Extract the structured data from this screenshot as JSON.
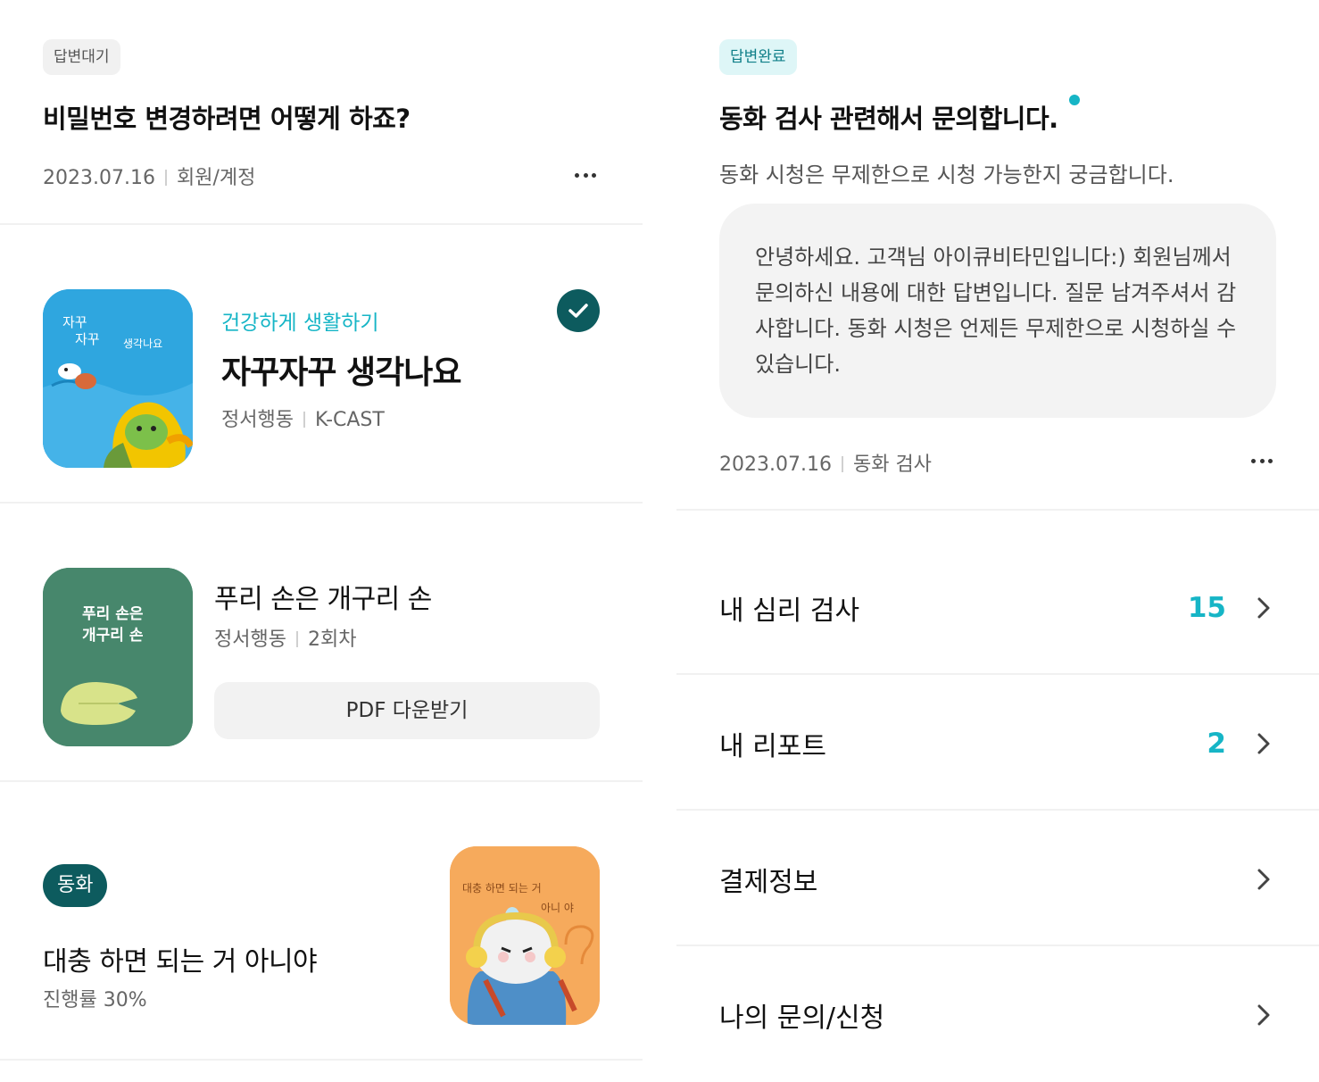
{
  "inquiry_pending": {
    "status": "답변대기",
    "title": "비밀번호 변경하려면 어떻게 하죠?",
    "date": "2023.07.16",
    "category": "회원/계정"
  },
  "content_card": {
    "thumb_text_line1": "자꾸",
    "thumb_text_line2": "자꾸",
    "thumb_text_line3": "생각나요",
    "category": "건강하게 생활하기",
    "title": "자꾸자꾸 생각나요",
    "tag": "정서행동",
    "source": "K-CAST",
    "check_color": "#0d5b5e"
  },
  "pdf_card": {
    "thumb_text_line1": "푸리 손은",
    "thumb_text_line2": "개구리 손",
    "title": "푸리 손은 개구리 손",
    "tag": "정서행동",
    "episode": "2회차",
    "button_label": "PDF 다운받기"
  },
  "progress_card": {
    "badge": "동화",
    "title": "대충 하면 되는 거 아니야",
    "progress_text": "진행률 30%",
    "thumb_text_line1": "대충 하면 되는 거",
    "thumb_text_line2": "아니 야"
  },
  "inquiry_done": {
    "status": "답변완료",
    "title": "동화 검사  관련해서 문의합니다.",
    "question": "동화 시청은 무제한으로 시청 가능한지 궁금합니다.",
    "answer": "안녕하세요. 고객님 아이큐비타민입니다:) 회원님께서 문의하신 내용에 대한 답변입니다. 질문 남겨주셔서 감사합니다. 동화 시청은 언제든 무제한으로 시청하실 수 있습니다.",
    "date": "2023.07.16",
    "category": "동화 검사",
    "accent": "#16b5c6"
  },
  "menu": [
    {
      "label": "내 심리 검사",
      "count": "15"
    },
    {
      "label": "내 리포트",
      "count": "2"
    },
    {
      "label": "결제정보",
      "count": ""
    },
    {
      "label": "나의 문의/신청",
      "count": ""
    }
  ]
}
